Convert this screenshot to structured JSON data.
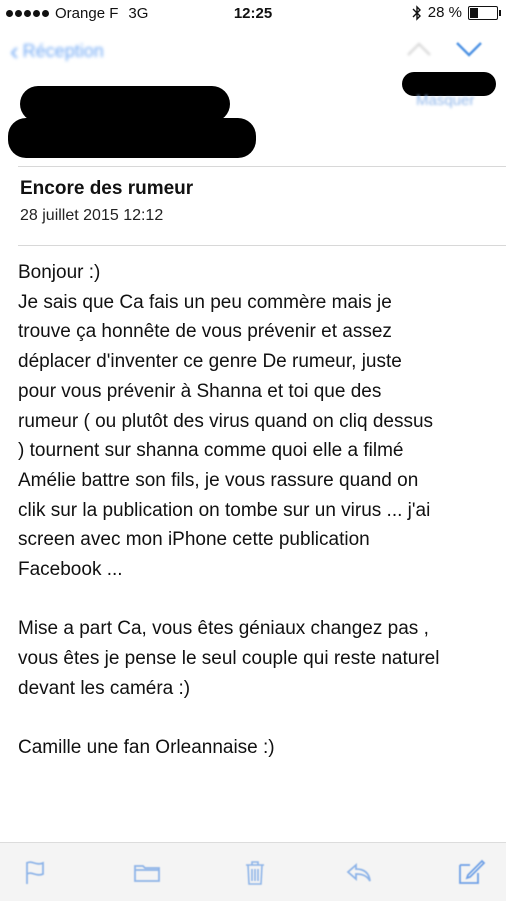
{
  "status_bar": {
    "carrier": "Orange F",
    "network": "3G",
    "time": "12:25",
    "battery": "28 %",
    "battery_level": 0.28
  },
  "navbar": {
    "back_label": "Réception",
    "icons": [
      "chevron-left-icon",
      "chevron-up-icon",
      "chevron-down-icon"
    ]
  },
  "sender": {
    "hide_label": "Masquer"
  },
  "message": {
    "subject": "Encore des rumeur",
    "date": "28 juillet 2015 12:12",
    "lines": [
      "Bonjour :)",
      "Je sais que Ca fais un peu commère mais je",
      "trouve ça honnête de vous prévenir et assez",
      "déplacer d'inventer ce genre De rumeur, juste",
      "pour vous prévenir à Shanna et toi que des",
      "rumeur ( ou plutôt des virus quand on cliq dessus",
      ") tournent sur shanna comme quoi elle a filmé",
      "Amélie battre son fils, je vous rassure quand on",
      "clik sur la publication on tombe sur un virus ...  j'ai",
      "screen avec mon iPhone cette publication",
      "Facebook ...",
      "",
      "Mise a part Ca, vous êtes géniaux changez pas ,",
      "vous êtes je pense le seul couple qui reste naturel",
      "devant les caméra :)",
      "",
      "Camille une fan Orleannaise :)"
    ]
  },
  "toolbar": {
    "icons": [
      "flag-icon",
      "folder-icon",
      "trash-icon",
      "reply-icon",
      "compose-icon"
    ]
  },
  "colors": {
    "accent": "#4a90e2",
    "toolbar_bg": "#f4f4f4"
  }
}
